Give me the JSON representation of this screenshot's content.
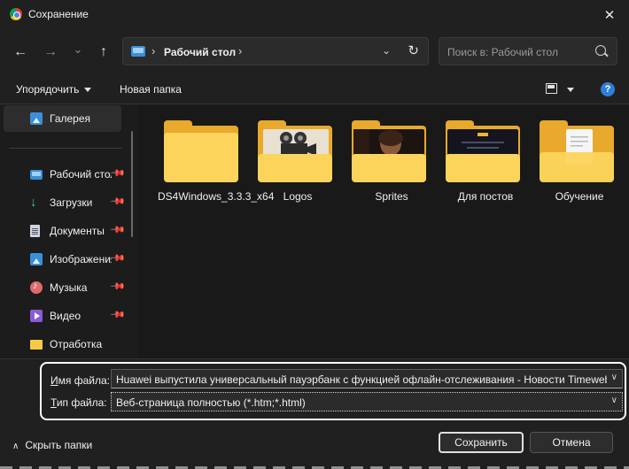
{
  "window": {
    "title": "Сохранение",
    "close_glyph": "✕"
  },
  "nav": {
    "back_glyph": "←",
    "forward_glyph": "→",
    "recent_glyph": "⌄",
    "up_glyph": "↑",
    "address": "Рабочий стол",
    "separator": "›",
    "refresh_glyph": "↻",
    "search_placeholder": "Поиск в: Рабочий стол"
  },
  "commands": {
    "organize": "Упорядочить",
    "new_folder": "Новая папка",
    "help": "?"
  },
  "sidebar": {
    "pin_glyph": "📌",
    "items": [
      {
        "label": "Галерея",
        "icon": "gallery-icon",
        "pinned": false,
        "selected": true
      },
      {
        "label": "Рабочий стол",
        "icon": "desktop-icon",
        "pinned": true
      },
      {
        "label": "Загрузки",
        "icon": "download-icon",
        "pinned": true,
        "glyph": "↓"
      },
      {
        "label": "Документы",
        "icon": "documents-icon",
        "pinned": true
      },
      {
        "label": "Изображения",
        "icon": "pictures-icon",
        "pinned": true
      },
      {
        "label": "Музыка",
        "icon": "music-icon",
        "pinned": true
      },
      {
        "label": "Видео",
        "icon": "video-icon",
        "pinned": true
      },
      {
        "label": "Отработка",
        "icon": "folder-icon",
        "pinned": false
      }
    ]
  },
  "folders": [
    {
      "name": "DS4Windows_3.3.3_x64",
      "preview": "none"
    },
    {
      "name": "Logos",
      "preview": "film-camera"
    },
    {
      "name": "Sprites",
      "preview": "dark-portrait"
    },
    {
      "name": "Для постов",
      "preview": "dark-page"
    },
    {
      "name": "Обучение",
      "preview": "white-document"
    }
  ],
  "form": {
    "filename_label_underlined": "И",
    "filename_label_rest": "мя файла:",
    "filename_value": "Huawei выпустила универсальный пауэрбанк с функцией офлайн-отслеживания - Новости Timeweb Community",
    "filetype_label_underlined": "Т",
    "filetype_label_rest": "ип файла:",
    "filetype_value": "Веб-страница полностью (*.htm;*.html)",
    "dropdown_glyph": "∨"
  },
  "footer": {
    "hide_folders": "Скрыть папки",
    "hide_glyph": "∧",
    "save": "Сохранить",
    "cancel": "Отмена"
  },
  "colors": {
    "background": "#1e1e1e",
    "folder": "#fcd45b",
    "accent": "#2f7fd8"
  }
}
